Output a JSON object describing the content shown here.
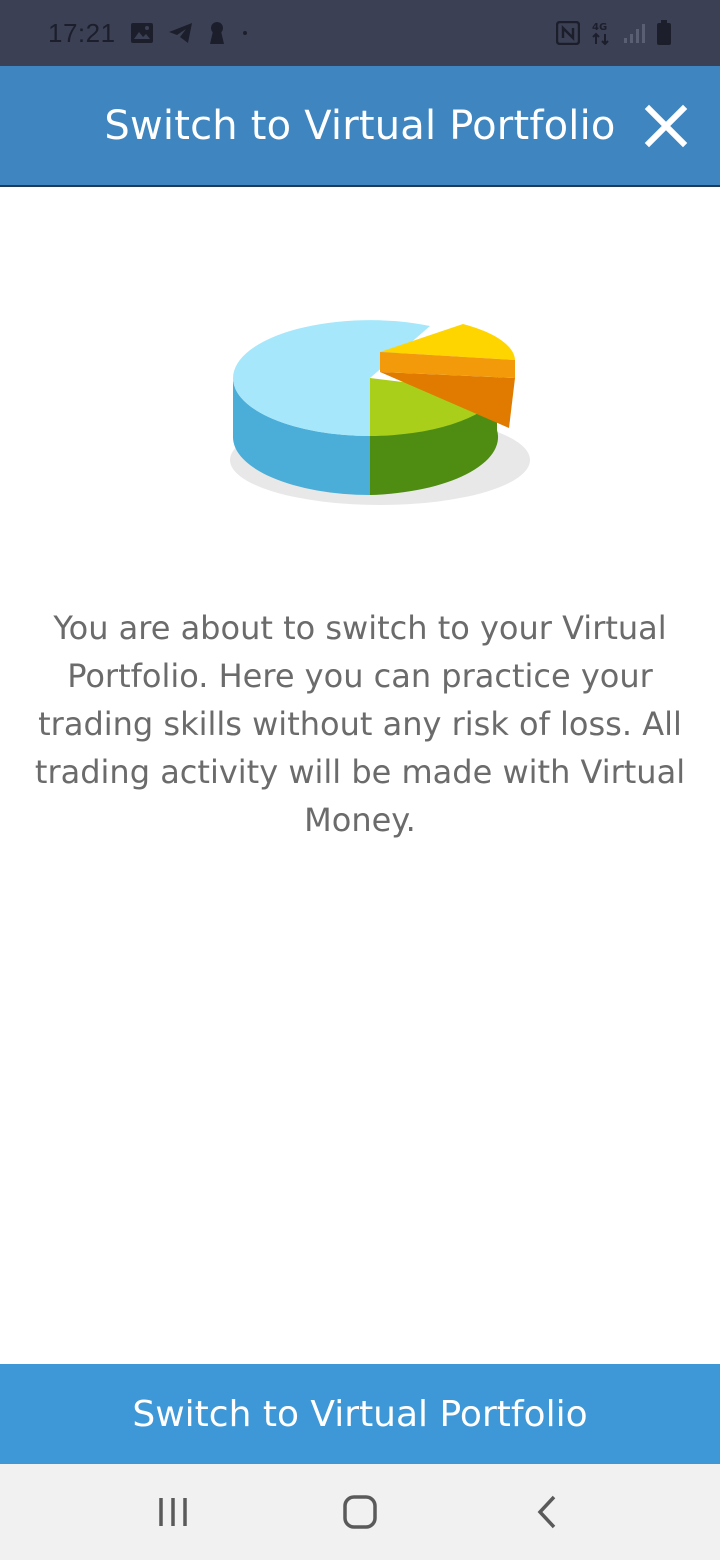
{
  "status_bar": {
    "time": "17:21",
    "left_icons": [
      "image-icon",
      "telegram-icon",
      "keyhole-icon",
      "dot-icon"
    ],
    "right_icons": [
      "nfc-icon",
      "4g-data-icon",
      "signal-icon",
      "battery-icon"
    ],
    "network_label": "4G"
  },
  "dialog": {
    "title": "Switch to Virtual Portfolio",
    "close_icon": "close-icon",
    "illustration_icon": "pie-chart-illustration",
    "message": "You are about to switch to your Virtual Portfolio. Here you can practice your trading skills without any risk of loss. All trading activity will be made with Virtual Money.",
    "primary_button_label": "Switch to Virtual Portfolio"
  },
  "nav_bar": {
    "recent_icon": "recent-apps-icon",
    "home_icon": "home-icon",
    "back_icon": "back-icon"
  },
  "colors": {
    "header_bg": "#3f86c0",
    "button_bg": "#3e98d8",
    "status_bg": "#3b4055",
    "text_gray": "#6b6b6b"
  }
}
